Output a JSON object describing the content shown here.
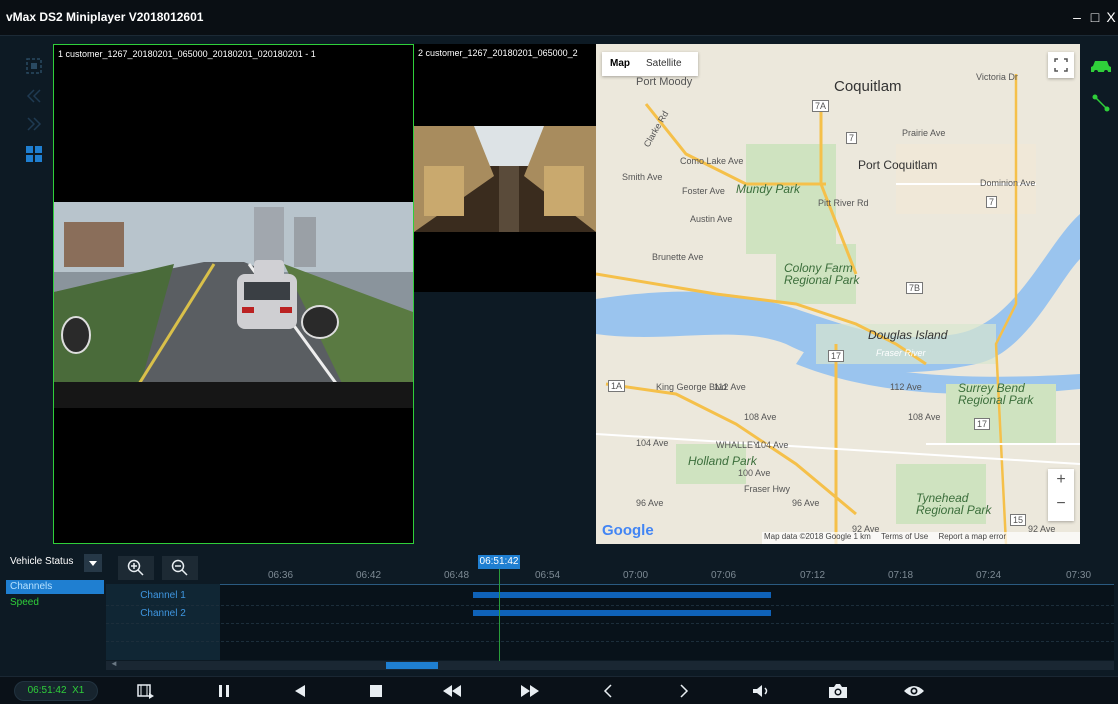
{
  "window": {
    "title": "vMax DS2 Miniplayer V2018012601",
    "minimize": "–",
    "maximize": "□",
    "close": "X"
  },
  "panes": {
    "pane1_label": "1 customer_1267_20180201_065000_20180201_020180201 - 1",
    "pane2_label": "2 customer_1267_20180201_065000_2"
  },
  "map": {
    "tab_map": "Map",
    "tab_satellite": "Satellite",
    "fullscreen_icon": "fullscreen-icon",
    "zoom_in": "+",
    "zoom_out": "−",
    "google_logo": "Google",
    "attribution": "Map data ©2018 Google   1 km",
    "terms": "Terms of Use",
    "report": "Report a map error",
    "labels": {
      "port_moody": "Port Moody",
      "coquitlam": "Coquitlam",
      "port_coquitlam": "Port Coquitlam",
      "mundy_park": "Mundy Park",
      "colony_farm": "Colony Farm Regional Park",
      "douglas_island": "Douglas Island",
      "fraser_river": "Fraser River",
      "surrey_bend": "Surrey Bend Regional Park",
      "holland_park": "Holland Park",
      "tynehead": "Tynehead Regional Park",
      "victoria_dr": "Victoria Dr",
      "prairie_ave": "Prairie Ave",
      "dominion_ave": "Dominion Ave",
      "como_lake": "Como Lake Ave",
      "smith_ave": "Smith Ave",
      "foster_ave": "Foster Ave",
      "austin_ave": "Austin Ave",
      "brunette_ave": "Brunette Ave",
      "pitt_river_rd": "Pitt River Rd",
      "king_george": "King George Blvd",
      "ave_112": "112 Ave",
      "ave_108": "108 Ave",
      "ave_104": "104 Ave",
      "whalley": "WHALLEY",
      "ave_100": "100 Ave",
      "ave_96": "96 Ave",
      "ave_92": "92 Ave",
      "fraser_hwy": "Fraser Hwy",
      "clarke_rd": "Clarke Rd",
      "route_7a": "7A",
      "route_7": "7",
      "route_7b": "7B",
      "route_17": "17",
      "route_1a": "1A",
      "route_15": "15"
    }
  },
  "sidebar": {
    "dropdown_label": "Vehicle Status",
    "items": [
      "Channels",
      "Speed"
    ]
  },
  "timeline": {
    "current_time_marker": "06:51:42",
    "ticks": [
      "06:36",
      "06:42",
      "06:48",
      "06:54",
      "07:00",
      "07:06",
      "07:12",
      "07:18",
      "07:24",
      "07:30"
    ],
    "channels": [
      "Channel 1",
      "Channel 2"
    ]
  },
  "controls": {
    "time_display": "06:51:42",
    "speed": "X1"
  },
  "colors": {
    "accent": "#1f7fd1",
    "bar": "#0f62b8",
    "active_border": "#2fcf3a",
    "marker": "#2a9d3a"
  }
}
